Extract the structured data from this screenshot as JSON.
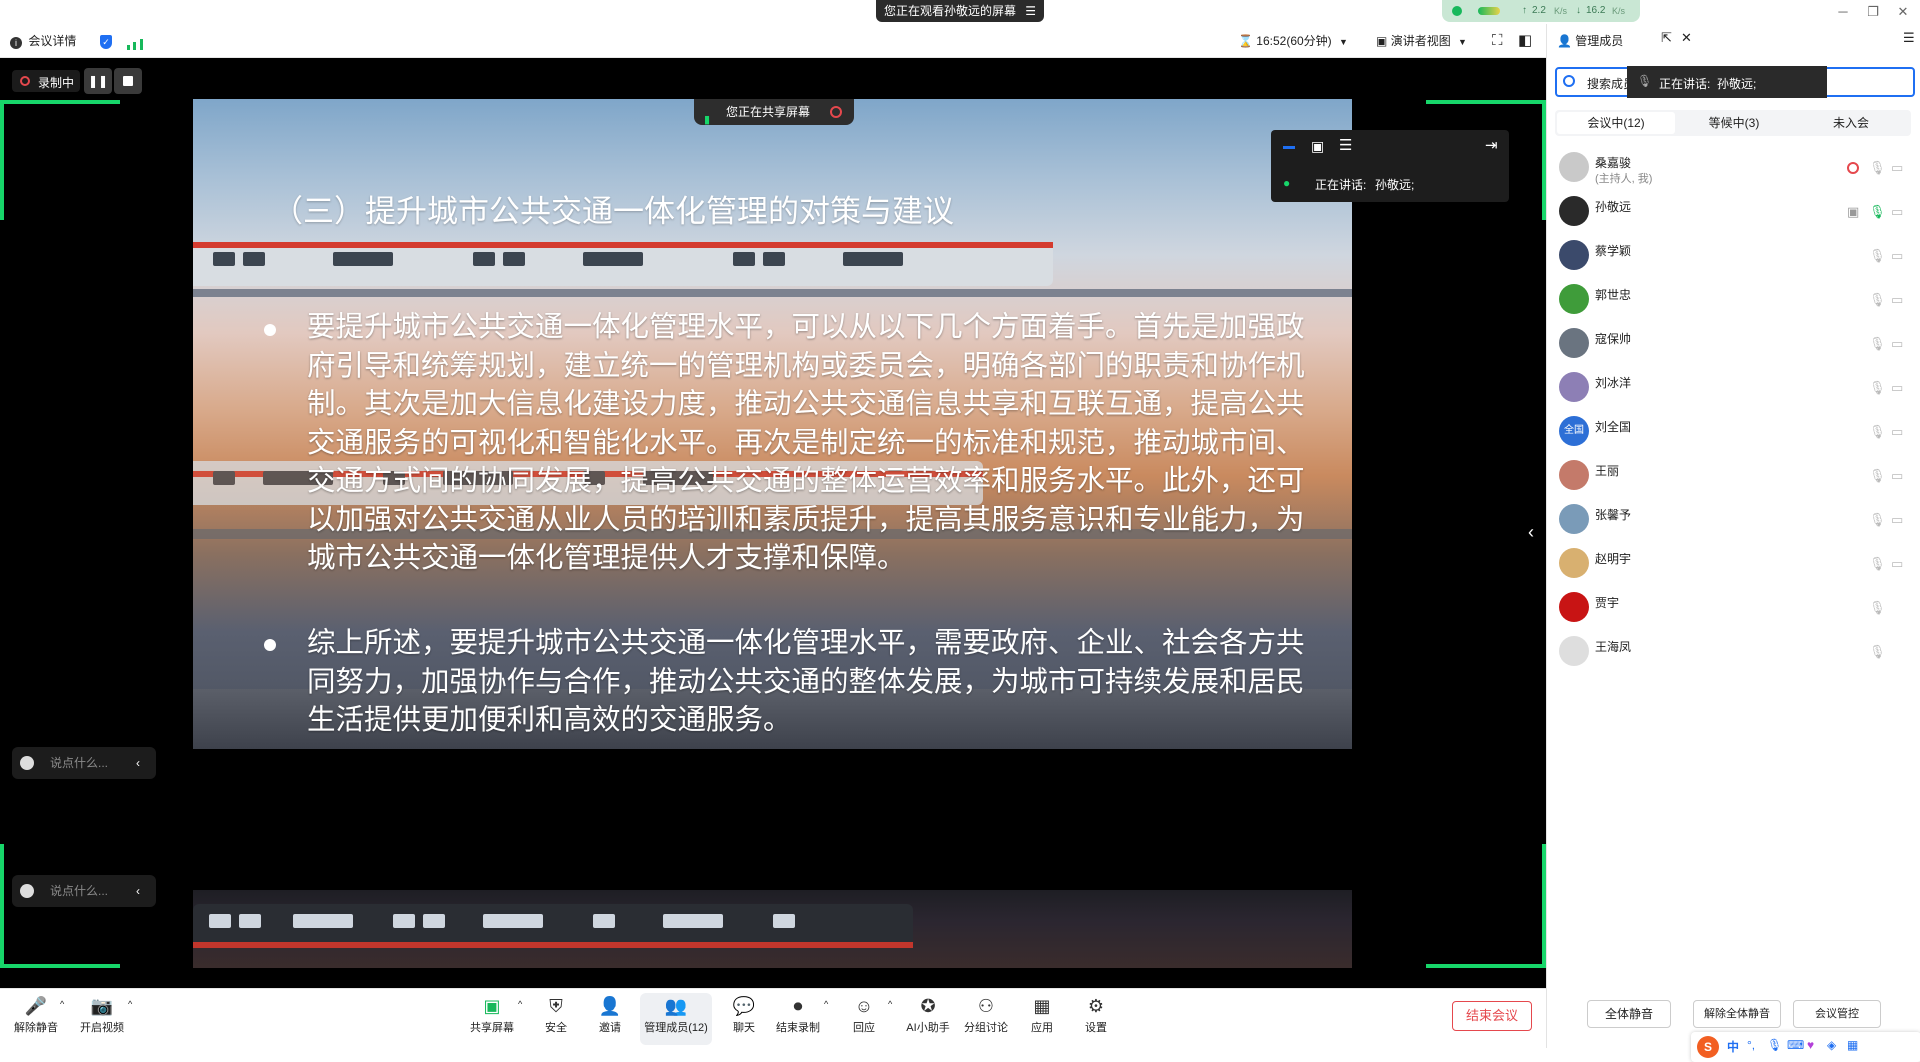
{
  "title_bar": {
    "viewing_notice": "您正在观看孙敬远的屏幕",
    "net_up": "2.2",
    "net_down": "16.2",
    "net_unit": "K/s"
  },
  "top_toolbar": {
    "meeting_info": "会议详情",
    "timer": "16:52(60分钟)",
    "view_mode": "演讲者视图"
  },
  "recording": {
    "label": "录制中"
  },
  "share_notice": "您正在共享屏幕",
  "speaking": {
    "label": "正在讲话:",
    "name": "孙敬远;"
  },
  "slide": {
    "title": "（三）提升城市公共交通一体化管理的对策与建议",
    "paragraphs": [
      "要提升城市公共交通一体化管理水平，可以从以下几个方面着手。首先是加强政府引导和统筹规划，建立统一的管理机构或委员会，明确各部门的职责和协作机制。其次是加大信息化建设力度，推动公共交通信息共享和互联互通，提高公共交通服务的可视化和智能化水平。再次是制定统一的标准和规范，推动城市间、交通方式间的协同发展，提高公共交通的整体运营效率和服务水平。此外，还可以加强对公共交通从业人员的培训和素质提升，提高其服务意识和专业能力，为城市公共交通一体化管理提供人才支撑和保障。",
      "综上所述，要提升城市公共交通一体化管理水平，需要政府、企业、社会各方共同努力，加强协作与合作，推动公共交通的整体发展，为城市可持续发展和居民生活提供更加便利和高效的交通服务。"
    ]
  },
  "chat": {
    "placeholder": "说点什么..."
  },
  "panel": {
    "title": "管理成员",
    "search_placeholder": "搜索成员",
    "tabs": [
      "会议中(12)",
      "等候中(3)",
      "未入会"
    ],
    "members": [
      {
        "name": "桑嘉骏",
        "role": "(主持人, 我)",
        "avatar_color": "#c9c9c9",
        "avatar_text": ""
      },
      {
        "name": "孙敬远",
        "role": "",
        "avatar_color": "#2a2a2a",
        "avatar_text": ""
      },
      {
        "name": "蔡学颖",
        "role": "",
        "avatar_color": "#3b4a6b",
        "avatar_text": ""
      },
      {
        "name": "郭世忠",
        "role": "",
        "avatar_color": "#3f9c3a",
        "avatar_text": ""
      },
      {
        "name": "寇保帅",
        "role": "",
        "avatar_color": "#6a7480",
        "avatar_text": ""
      },
      {
        "name": "刘冰洋",
        "role": "",
        "avatar_color": "#8d7fb5",
        "avatar_text": ""
      },
      {
        "name": "刘全国",
        "role": "",
        "avatar_color": "#2d6fd6",
        "avatar_text": "全国"
      },
      {
        "name": "王丽",
        "role": "",
        "avatar_color": "#c47a6a",
        "avatar_text": ""
      },
      {
        "name": "张馨予",
        "role": "",
        "avatar_color": "#7a9bb8",
        "avatar_text": ""
      },
      {
        "name": "赵明宇",
        "role": "",
        "avatar_color": "#d8b070",
        "avatar_text": ""
      },
      {
        "name": "贾宇",
        "role": "",
        "avatar_color": "#c81414",
        "avatar_text": ""
      },
      {
        "name": "王海凤",
        "role": "",
        "avatar_color": "#dedede",
        "avatar_text": ""
      }
    ],
    "mute_all": "全体静音",
    "unmute_all": "解除全体静音",
    "more": "会议管控"
  },
  "bottom_toolbar": {
    "unmute": "解除静音",
    "start_video": "开启视频",
    "share_screen": "共享屏幕",
    "security": "安全",
    "invite": "邀请",
    "manage_members": "管理成员(12)",
    "chat": "聊天",
    "end_recording": "结束录制",
    "reactions": "回应",
    "ai_assistant": "AI小助手",
    "breakout": "分组讨论",
    "apps": "应用",
    "settings": "设置",
    "end_meeting": "结束会议"
  },
  "colors": {
    "accent_green": "#17d66a",
    "accent_blue": "#1f6ff2",
    "danger_red": "#e5484d"
  }
}
